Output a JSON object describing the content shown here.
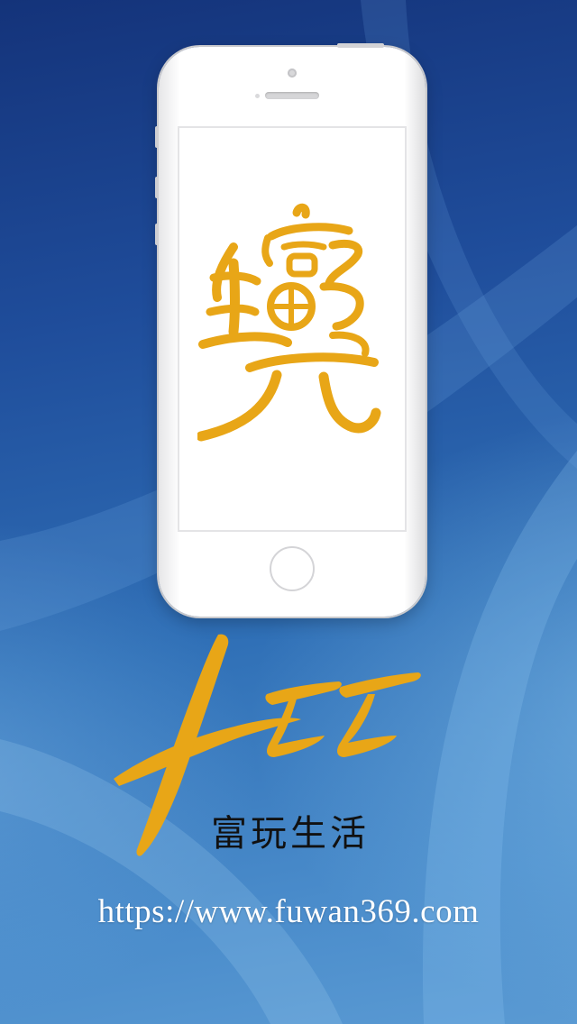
{
  "brand": {
    "name_cn": "富玩生活",
    "url": "https://www.fuwan369.com",
    "accent_color": "#E8A617",
    "screen_logo_icon": "calligraphy-logo-icon",
    "mark_icon": "calligraphy-brush-mark-icon"
  },
  "background": {
    "top_color": "#14337A",
    "bottom_color": "#5A9AD3"
  },
  "device": {
    "type": "smartphone-frame",
    "color": "#FFFFFF"
  }
}
